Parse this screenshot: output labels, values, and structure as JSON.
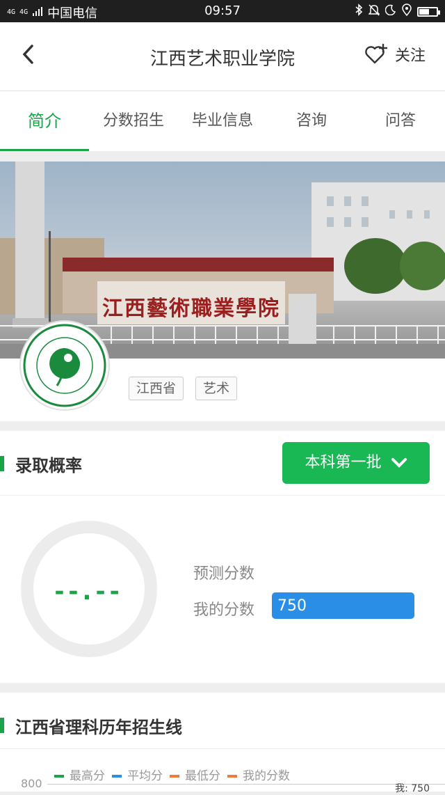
{
  "status_bar": {
    "network": "4G 4G",
    "carrier": "中国电信",
    "time": "09:57",
    "battery_level": 0.65
  },
  "header": {
    "title": "江西艺术职业学院",
    "follow_label": "关注"
  },
  "tabs": [
    {
      "label": "简介",
      "active": true
    },
    {
      "label": "分数招生",
      "active": false
    },
    {
      "label": "毕业信息",
      "active": false
    },
    {
      "label": "咨询",
      "active": false
    },
    {
      "label": "问答",
      "active": false
    }
  ],
  "banner": {
    "gate_text": "江西藝術職業學院"
  },
  "tags": [
    "江西省",
    "艺术"
  ],
  "admission": {
    "title": "录取概率",
    "batch_dropdown": "本科第一批",
    "probability": "--.--",
    "predicted_label": "预测分数",
    "my_score_label": "我的分数",
    "my_score": "750"
  },
  "history": {
    "title": "江西省理科历年招生线",
    "legend": [
      {
        "label": "最高分",
        "color": "#1aa347"
      },
      {
        "label": "平均分",
        "color": "#2b8ee6"
      },
      {
        "label": "最低分",
        "color": "#f07a3a"
      },
      {
        "label": "我的分数",
        "color": "#f07a3a"
      }
    ],
    "y_tick": "800",
    "me_label": "我: 750"
  },
  "colors": {
    "accent": "#1aa347",
    "button": "#1ab855",
    "score_blue": "#2b8ee6"
  }
}
